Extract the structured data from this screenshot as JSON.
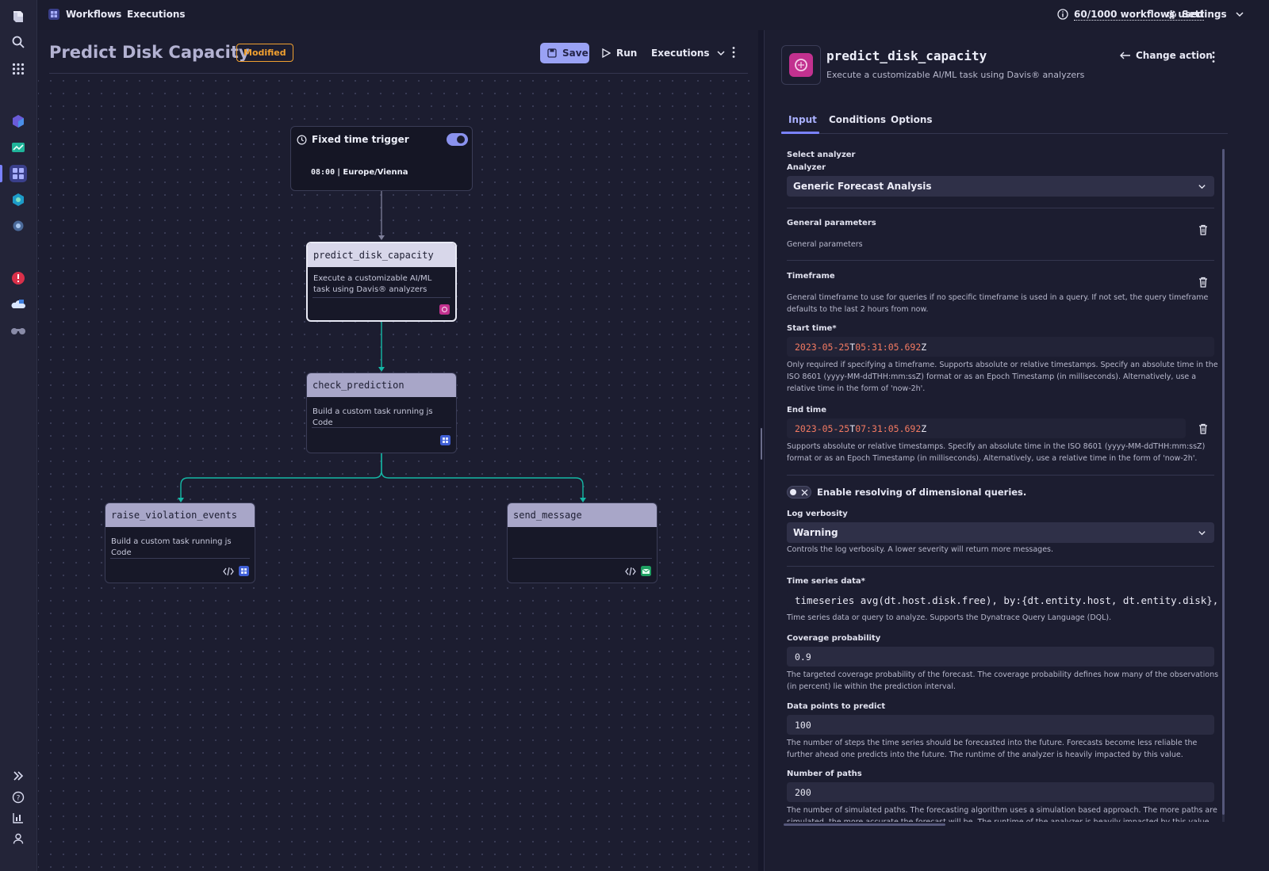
{
  "topbar": {
    "nav_workflows": "Workflows",
    "nav_executions": "Executions",
    "usage": "60/1000 workflows used",
    "settings": "Settings"
  },
  "workflow": {
    "title": "Predict Disk Capacity",
    "badge": "Modified",
    "save": "Save",
    "run": "Run",
    "executions": "Executions"
  },
  "nodes": {
    "trigger": {
      "title": "Fixed time trigger",
      "time": "08:00",
      "timezone": "| Europe/Vienna",
      "enabled": true
    },
    "predict": {
      "title": "predict_disk_capacity",
      "desc": "Execute a customizable AI/ML task using Davis® analyzers"
    },
    "check": {
      "title": "check_prediction",
      "desc": "Build a custom task running js Code"
    },
    "raise": {
      "title": "raise_violation_events",
      "desc": "Build a custom task running js Code"
    },
    "send": {
      "title": "send_message",
      "desc": ""
    }
  },
  "panel": {
    "task_name": "predict_disk_capacity",
    "task_desc": "Execute a customizable AI/ML task using Davis® analyzers",
    "change_action": "Change action",
    "tabs": [
      "Input",
      "Conditions",
      "Options"
    ],
    "select_analyzer": "Select analyzer",
    "analyzer_label": "Analyzer",
    "analyzer_value": "Generic Forecast Analysis",
    "general_title": "General parameters",
    "general_sub": "General parameters",
    "timeframe_title": "Timeframe",
    "timeframe_help": "General timeframe to use for queries if no specific timeframe is used in a query. If not set, the query timeframe defaults to the last 2 hours from now.",
    "start_label": "Start time*",
    "start_date": "2023-05-25",
    "start_t": "T",
    "start_time": "05:31:05.692",
    "start_z": "Z",
    "start_help": "Only required if specifying a timeframe. Supports absolute or relative timestamps. Specify an absolute time in the ISO 8601 (yyyy-MM-ddTHH:mm:ssZ) format or as an Epoch Timestamp (in milliseconds). Alternatively, use a relative time in the form of 'now-2h'.",
    "end_label": "End time",
    "end_date": "2023-05-25",
    "end_t": "T",
    "end_time": "07:31:05.692",
    "end_z": "Z",
    "end_help": "Supports absolute or relative timestamps. Specify an absolute time in the ISO 8601 (yyyy-MM-ddTHH:mm:ssZ) format or as an Epoch Timestamp (in milliseconds). Alternatively, use a relative time in the form of 'now-2h'.",
    "dimensional_label": "Enable resolving of dimensional queries.",
    "log_label": "Log verbosity",
    "log_value": "Warning",
    "log_help": "Controls the log verbosity. A lower severity will return more messages.",
    "ts_label": "Time series data*",
    "ts_value": "timeseries avg(dt.host.disk.free), by:{dt.entity.host, dt.entity.disk}, bins:",
    "ts_help": "Time series data or query to analyze. Supports the Dynatrace Query Language (DQL).",
    "coverage_label": "Coverage probability",
    "coverage_value": "0.9",
    "coverage_help": "The targeted coverage probability of the forecast. The coverage probability defines how many of the observations (in percent) lie within the prediction interval.",
    "points_label": "Data points to predict",
    "points_value": "100",
    "points_help": "The number of steps the time series should be forecasted into the future. Forecasts become less reliable the further ahead one predicts into the future. The runtime of the analyzer is heavily impacted by this value.",
    "paths_label": "Number of paths",
    "paths_value": "200",
    "paths_help": "The number of simulated paths. The forecasting algorithm uses a simulation based approach. The more paths are simulated, the more accurate the forecast will be. The runtime of the analyzer is heavily impacted by this value."
  },
  "colors": {
    "accent": "#7a82ff",
    "teal": "#14b8a6",
    "badge": "#f0a030",
    "timestamp": "#f47a62"
  }
}
